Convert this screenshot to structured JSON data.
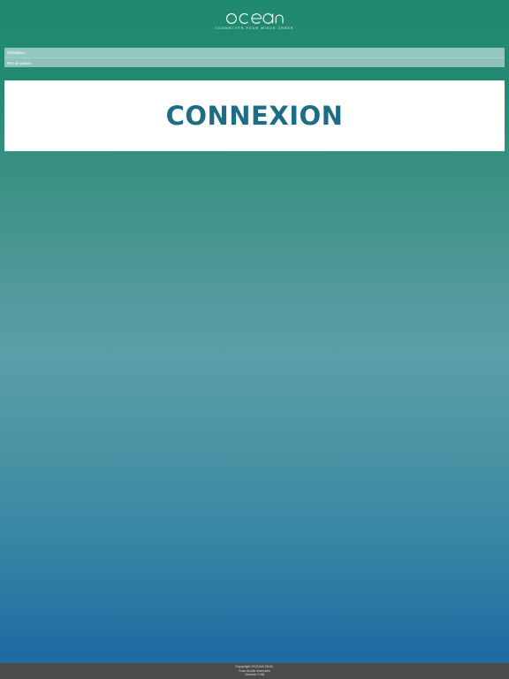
{
  "header": {
    "logo_text": "ocean",
    "tagline": "CONNECTER POUR MIEUX CRÉER",
    "logo_color": "#ffffff"
  },
  "login_form": {
    "username_placeholder": "Utilisateur",
    "password_placeholder": "Mot de passe",
    "connect_label": "CONNEXION"
  },
  "footer": {
    "copyright": "Copyright OCEAN 2016.",
    "rights": "Tous droits réservés.",
    "version": "Version 0.98"
  },
  "colors": {
    "gradient_top": "#1f8a6e",
    "gradient_mid": "#5a9fa8",
    "gradient_bottom": "#1e6aa3",
    "button_text": "#1e6d87",
    "footer_bg": "#4b4b4b"
  }
}
